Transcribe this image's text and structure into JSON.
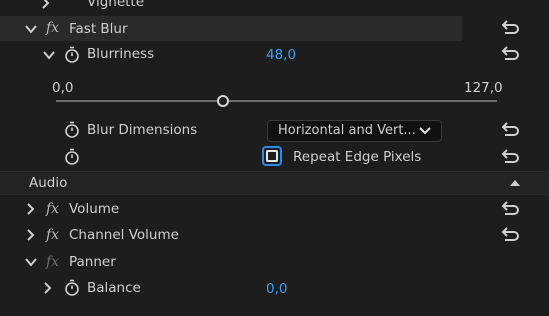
{
  "effects": {
    "vignette": {
      "label": "Vignette"
    },
    "fast_blur": {
      "label": "Fast Blur",
      "blurriness": {
        "label": "Blurriness",
        "value": "48,0"
      },
      "slider": {
        "min_label": "0,0",
        "max_label": "127,0",
        "fraction": 0.378
      },
      "blur_dimensions": {
        "label": "Blur Dimensions",
        "selected": "Horizontal and Vert..."
      },
      "repeat_edge": {
        "label": "Repeat Edge Pixels",
        "checked": false
      }
    }
  },
  "audio": {
    "section_label": "Audio",
    "volume": {
      "label": "Volume"
    },
    "channel_volume": {
      "label": "Channel Volume"
    },
    "panner": {
      "label": "Panner",
      "balance": {
        "label": "Balance",
        "value": "0,0"
      }
    }
  },
  "colors": {
    "panel_bg": "#1d1d1d",
    "header_bg": "#2a2a2a",
    "value_blue": "#3d9ef5",
    "focus_blue": "#2d8ceb"
  },
  "icons": [
    "chevron-right-icon",
    "chevron-down-icon",
    "fx-icon",
    "stopwatch-icon",
    "reset-icon",
    "collapse-up-icon",
    "checkbox-icon",
    "dropdown-chevron-icon"
  ]
}
